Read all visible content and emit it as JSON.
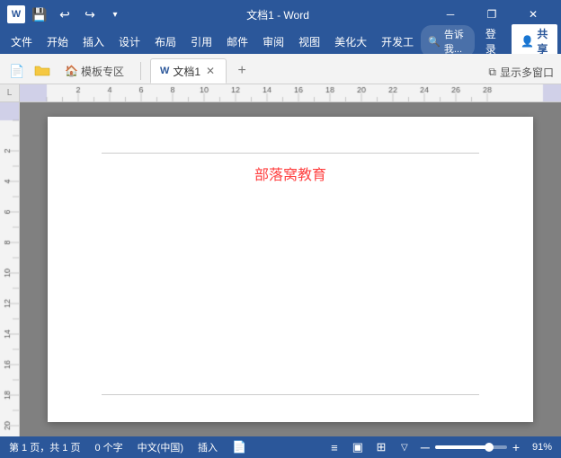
{
  "titlebar": {
    "title": "文档1 - Word",
    "save_icon": "💾",
    "undo_icon": "↩",
    "redo_icon": "↪",
    "dropdown_icon": "▾",
    "minimize": "─",
    "restore": "❐",
    "close": "✕"
  },
  "menubar": {
    "items": [
      "文件",
      "开始",
      "插入",
      "设计",
      "布局",
      "引用",
      "邮件",
      "审阅",
      "视图",
      "美化大",
      "开发工"
    ],
    "tellme_placeholder": "告诉我...",
    "login": "登录",
    "share": "共享"
  },
  "tabbar": {
    "template_zone": "模板专区",
    "doc_tab": "文档1",
    "new_tab_plus": "+",
    "display_multi": "显示多窗口"
  },
  "document": {
    "title_text": "部落窝教育"
  },
  "statusbar": {
    "page_info": "第 1 页，共 1 页",
    "char_count": "0 个字",
    "language": "中文(中国)",
    "insert_mode": "插入",
    "zoom_percent": "91%"
  },
  "colors": {
    "word_blue": "#2b579a",
    "doc_title_red": "#ff4040",
    "ribbon_bg": "#f3f3f3"
  }
}
